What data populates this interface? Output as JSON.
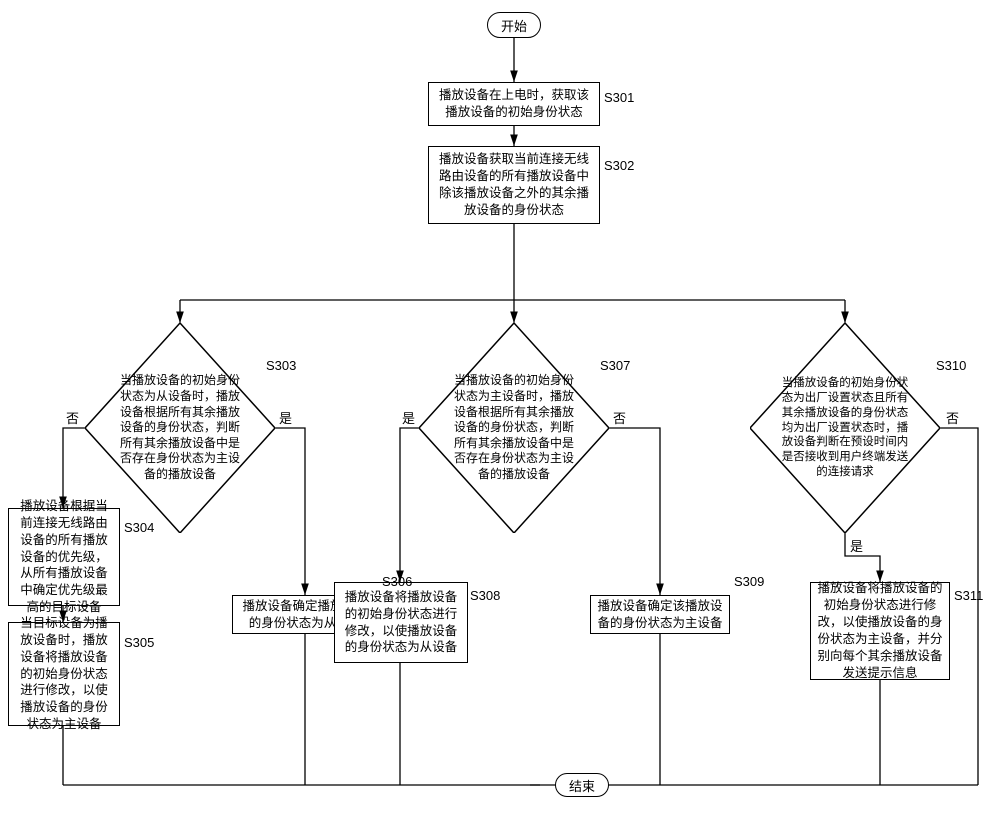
{
  "terminators": {
    "start": "开始",
    "end": "结束"
  },
  "steps": {
    "s301": {
      "label": "S301",
      "text": "播放设备在上电时，获取该播放设备的初始身份状态"
    },
    "s302": {
      "label": "S302",
      "text": "播放设备获取当前连接无线路由设备的所有播放设备中除该播放设备之外的其余播放设备的身份状态"
    },
    "s303": {
      "label": "S303",
      "text": "当播放设备的初始身份状态为从设备时，播放设备根据所有其余播放设备的身份状态，判断所有其余播放设备中是否存在身份状态为主设备的播放设备"
    },
    "s304": {
      "label": "S304",
      "text": "播放设备根据当前连接无线路由设备的所有播放设备的优先级，从所有播放设备中确定优先级最高的目标设备"
    },
    "s305": {
      "label": "S305",
      "text": "当目标设备为播放设备时，播放设备将播放设备的初始身份状态进行修改，以使播放设备的身份状态为主设备"
    },
    "s306": {
      "label": "S306",
      "text": "播放设备确定播放设备的身份状态为从设备"
    },
    "s307": {
      "label": "S307",
      "text": "当播放设备的初始身份状态为主设备时，播放设备根据所有其余播放设备的身份状态，判断所有其余播放设备中是否存在身份状态为主设备的播放设备"
    },
    "s308": {
      "label": "S308",
      "text": "播放设备将播放设备的初始身份状态进行修改，以使播放设备的身份状态为从设备"
    },
    "s309": {
      "label": "S309",
      "text": "播放设备确定该播放设备的身份状态为主设备"
    },
    "s310": {
      "label": "S310",
      "text": "当播放设备的初始身份状态为出厂设置状态且所有其余播放设备的身份状态均为出厂设置状态时，播放设备判断在预设时间内是否接收到用户终端发送的连接请求"
    },
    "s311": {
      "label": "S311",
      "text": "播放设备将播放设备的初始身份状态进行修改，以使播放设备的身份状态为主设备，并分别向每个其余播放设备发送提示信息"
    }
  },
  "edges": {
    "yes": "是",
    "no": "否"
  }
}
